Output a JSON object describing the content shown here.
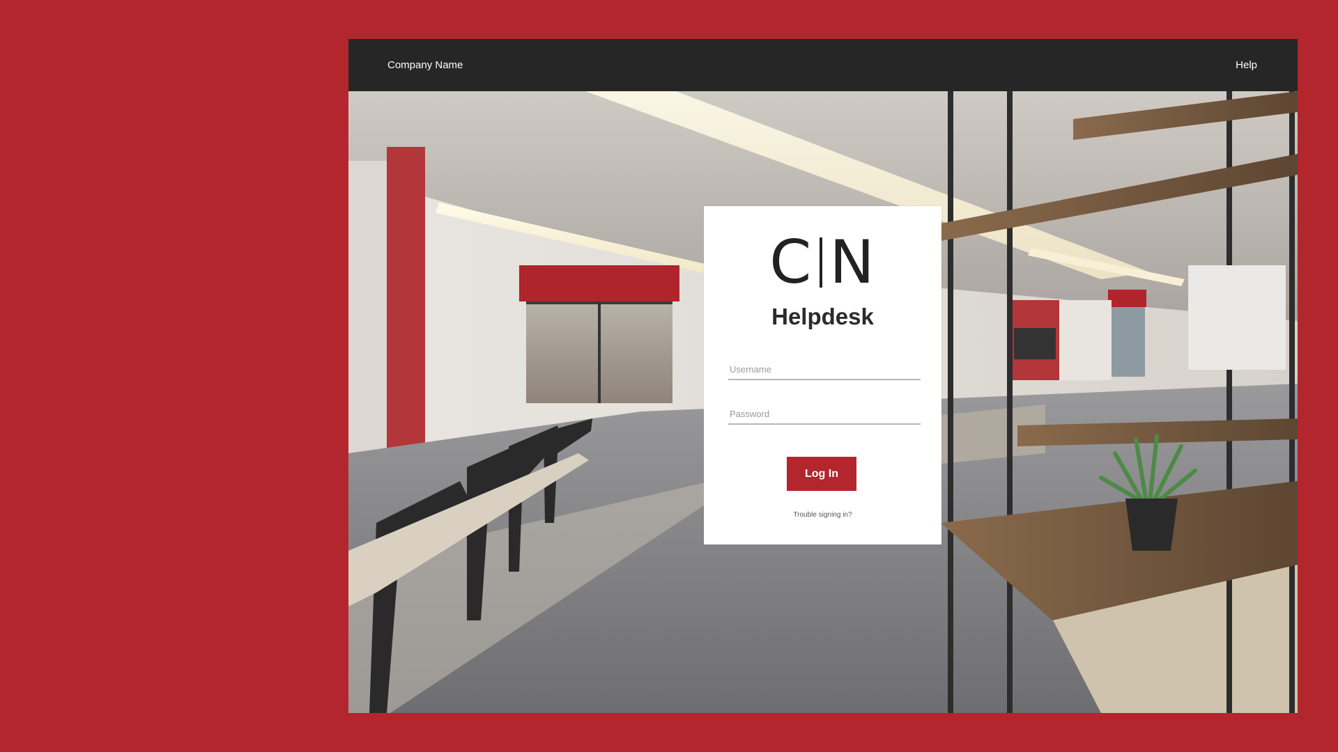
{
  "header": {
    "company_name": "Company Name",
    "help_label": "Help"
  },
  "login": {
    "logo_left": "C",
    "logo_right": "N",
    "title": "Helpdesk",
    "username_placeholder": "Username",
    "password_placeholder": "Password",
    "login_button": "Log In",
    "trouble_link": "Trouble signing in?"
  },
  "colors": {
    "accent": "#b3262e",
    "header_bg": "#262626",
    "card_bg": "#ffffff"
  }
}
